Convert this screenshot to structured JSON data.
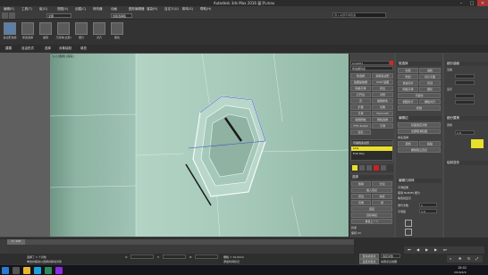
{
  "window": {
    "title": "Autodesk 3ds Max 2016   窗子Lmax",
    "minimize": "–",
    "maximize": "□",
    "close": "✕"
  },
  "menubar": {
    "items": [
      "编辑(E)",
      "工具(T)",
      "组(G)",
      "视图(V)",
      "创建(C)",
      "修改器",
      "动画",
      "图形编辑器",
      "渲染(R)",
      "自定义(U)",
      "脚本(S)",
      "帮助(H)"
    ]
  },
  "toolbar": {
    "selection_filter": "全部",
    "selection_set": "创建选择集",
    "search_placeholder": "键入关键字或短语"
  },
  "ribbon": {
    "tabs": [
      "建模",
      "自由形式",
      "选择",
      "对象绘制",
      "填充"
    ],
    "buttons": [
      "多边形建模",
      "修改选择",
      "编辑",
      "几何体(全部)",
      "细分",
      "对齐",
      "属性"
    ]
  },
  "viewport": {
    "label": "[+] [透视] [真实]"
  },
  "command_panel": {
    "object_name": "Line001",
    "modifier_list": "修改器列表",
    "modifiers": [
      "软选择",
      "编辑多边形",
      "贴图缩放器",
      "UVW 贴图",
      "网格平滑",
      "挤出",
      "打开边",
      "对称",
      "壳",
      "编辑样条",
      "扩展",
      "切角",
      "平滑",
      "Hsmooth",
      "编辑网格",
      "网格选择",
      "FFD 4x4x4",
      "平滑",
      "钻孔"
    ],
    "stack": [
      "可编辑多边形",
      "Line",
      "Edit Poly"
    ],
    "rollouts": [
      "选择",
      "软选择",
      "编辑边",
      "编辑几何体",
      "细分曲面",
      "细分置换",
      "绘制变形"
    ],
    "labels": [
      "移除",
      "分割",
      "插入顶点",
      "挤出",
      "焊接",
      "切角",
      "桥",
      "连接",
      "目标焊接",
      "重复上一个",
      "约束",
      "保持 UV",
      "创建",
      "塌陷",
      "附加",
      "切片平面",
      "快速切片",
      "切割",
      "网格平滑",
      "细化",
      "平面化",
      "视图对齐",
      "栅格对齐",
      "松弛",
      "隐藏选定对象",
      "全部取消隐藏",
      "命名选择",
      "复制",
      "粘贴",
      "删除孤立顶点",
      "平滑结果",
      "使用 NURMS 细分",
      "等值线显示",
      "迭代次数",
      "平滑度",
      "渲染",
      "显示",
      "置换"
    ],
    "values": {
      "iterations": "1",
      "smoothness": "1.0",
      "weight": "1.0"
    }
  },
  "status": {
    "selection": "选择了 1 个对象",
    "prompt": "单击并拖动以选择并移动对象",
    "frame": "0 / 100",
    "x": "X:",
    "y": "Y:",
    "z": "Z:",
    "grid": "栅格 = 10.0mm",
    "autokey": "自动关键点",
    "setkey": "设置关键点",
    "selected": "选定对象",
    "key_filter": "关键点过滤器",
    "add_time_tag": "添加时间标记"
  },
  "taskbar": {
    "time": "18:02",
    "date": "2016/4/9"
  },
  "colors": {
    "viewport_bg": "#8fb5a6",
    "accent_yellow": "#e8e02a",
    "panel_bg": "#4a4a4a"
  }
}
